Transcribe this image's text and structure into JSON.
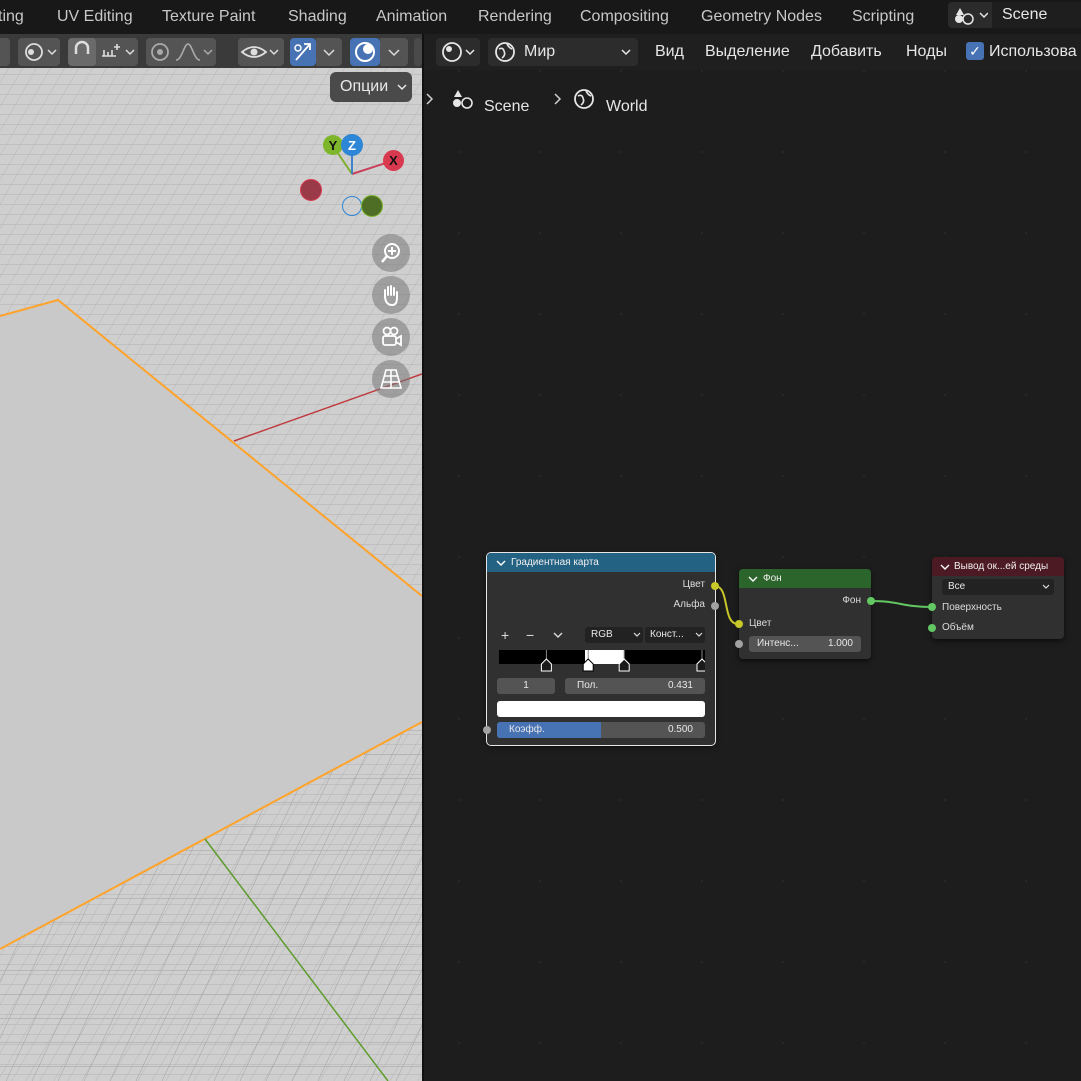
{
  "workspace_tabs": [
    "ting",
    "UV Editing",
    "Texture Paint",
    "Shading",
    "Animation",
    "Rendering",
    "Compositing",
    "Geometry Nodes",
    "Scripting"
  ],
  "scene": {
    "name": "Scene"
  },
  "viewport": {
    "options_label": "Опции",
    "gizmo": {
      "x": "X",
      "y": "Y",
      "z": "Z"
    },
    "nav_icons": [
      "zoom-icon",
      "hand-pan-icon",
      "camera-icon",
      "perspective-grid-icon"
    ]
  },
  "node_editor": {
    "world_name": "Мир",
    "menu": {
      "view": "Вид",
      "select": "Выделение",
      "add": "Добавить",
      "node": "Ноды"
    },
    "use_nodes_label": "Использова",
    "breadcrumb": {
      "scene": "Scene",
      "world": "World"
    }
  },
  "nodes": {
    "color_ramp": {
      "title": "Градиентная карта",
      "out_color": "Цвет",
      "out_alpha": "Альфа",
      "add": "+",
      "remove": "−",
      "mode": "RGB",
      "interpolation": "Конст...",
      "stop_index": "1",
      "pos_label": "Пол.",
      "pos_value": "0.431",
      "fac_label": "Коэфф.",
      "fac_value": "0.500",
      "fac": 0.5,
      "stops": [
        0.222,
        0.431,
        0.611,
        1.0
      ]
    },
    "background": {
      "title": "Фон",
      "out_background": "Фон",
      "in_color": "Цвет",
      "strength_label": "Интенс...",
      "strength_value": "1.000"
    },
    "world_output": {
      "title": "Вывод ок...ей среды",
      "target": "Все",
      "in_surface": "Поверхность",
      "in_volume": "Объём"
    }
  },
  "colors": {
    "accent": "#4772b3",
    "selection_orange": "#ffa32a",
    "color_socket": "#c7c729",
    "shader_socket": "#63c763",
    "value_socket": "#a1a1a1",
    "ramp_header": "#246283",
    "background_header": "#2b652b",
    "output_header": "#4c1a22"
  }
}
